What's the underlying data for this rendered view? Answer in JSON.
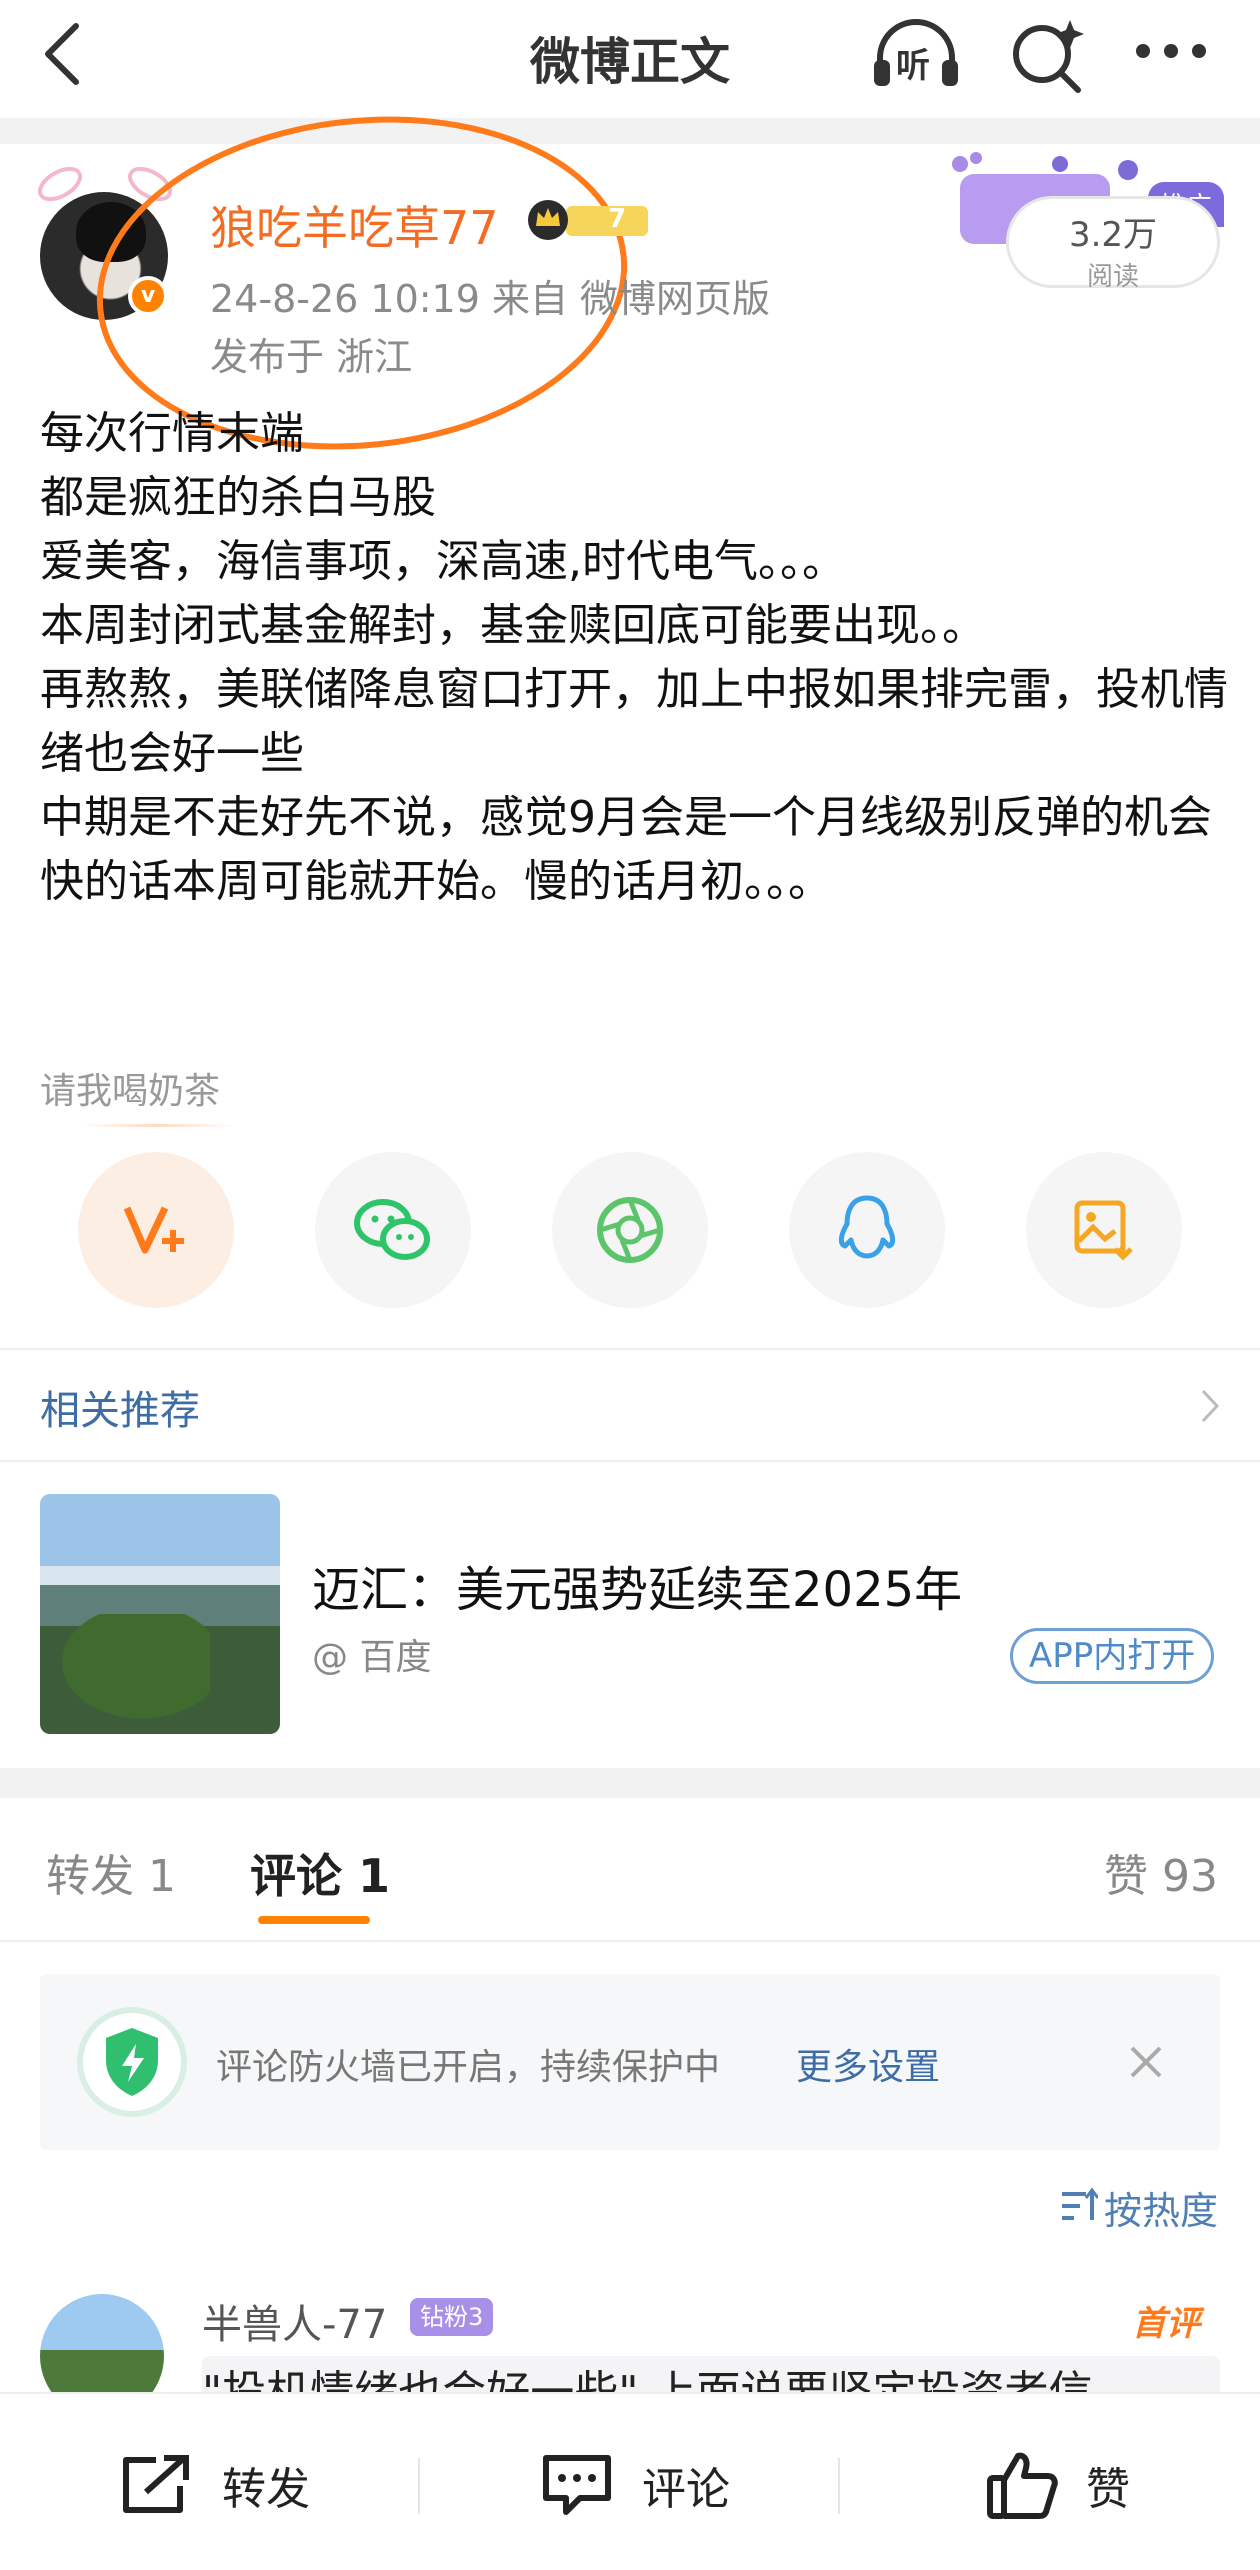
{
  "header": {
    "title": "微博正文",
    "listen_label": "听"
  },
  "post": {
    "username": "狼吃羊吃草77",
    "badge_level": "7",
    "time_source": "24-8-26 10:19  来自 微博网页版",
    "location": "发布于 浙江",
    "read_count": "3.2万",
    "read_label": "阅读",
    "promo_tag": "推广",
    "lines": [
      "每次行情末端",
      "都是疯狂的杀白马股",
      "爱美客，海信事项，深高速,时代电气。。。",
      "本周封闭式基金解封，基金赎回底可能要出现。。",
      "再熬熬，美联储降息窗口打开，加上中报如果排完雷，投机情绪也会好一些",
      "中期是不走好先不说，感觉9月会是一个月线级别反弹的机会",
      "快的话本周可能就开始。慢的话月初。。。"
    ],
    "tip_label": "请我喝奶茶"
  },
  "share": {
    "items": [
      {
        "name": "vip-plus-icon"
      },
      {
        "name": "wechat-icon"
      },
      {
        "name": "moments-icon"
      },
      {
        "name": "qq-icon"
      },
      {
        "name": "save-image-icon"
      }
    ]
  },
  "related": {
    "label": "相关推荐",
    "title": "迈汇：美元强势延续至2025年",
    "source": "@ 百度",
    "open_app": "APP内打开"
  },
  "tabs": {
    "repost": "转发 1",
    "comment": "评论 1",
    "like": "赞 93"
  },
  "firewall": {
    "text": "评论防火墙已开启，持续保护中",
    "more": "更多设置"
  },
  "sort": {
    "label": "按热度"
  },
  "comment": {
    "name": "半兽人-77",
    "badge": "钻粉3",
    "first": "首评",
    "text": "\"投机情绪也会好一些\" 上面说要坚定投资者信"
  },
  "bottom": {
    "repost": "转发",
    "comment": "评论",
    "like": "赞"
  },
  "colors": {
    "accent": "#ff8200",
    "username": "#f36c21",
    "link": "#3e6da6"
  }
}
